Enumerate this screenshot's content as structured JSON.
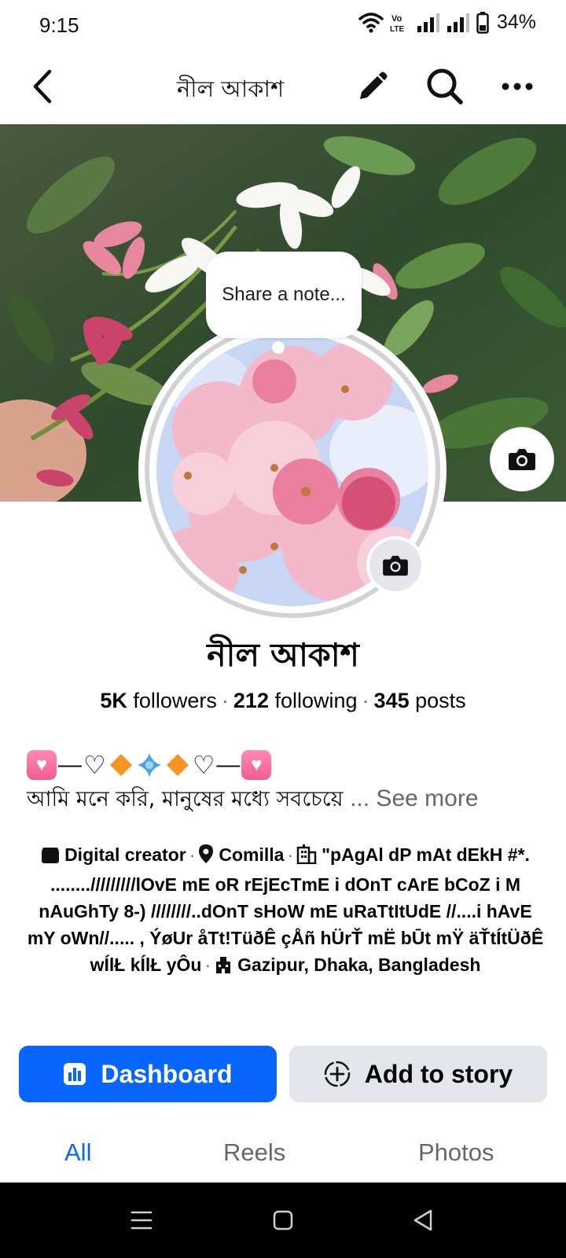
{
  "status_bar": {
    "time": "9:15",
    "battery": "34%"
  },
  "app_bar": {
    "title": "নীল আকাশ",
    "icons": [
      "back-icon",
      "pencil-icon",
      "search-icon",
      "more-icon"
    ]
  },
  "note": {
    "placeholder": "Share a note..."
  },
  "profile": {
    "name": "নীল আকাশ",
    "followers_count": "5K",
    "followers_label": "followers",
    "following_count": "212",
    "following_label": "following",
    "posts_count": "345",
    "posts_label": "posts"
  },
  "bio": {
    "text": "আমি মনে করি, মানুষের মধ্যে সবচেয়ে",
    "see_more": "... See more"
  },
  "details": {
    "category": "Digital creator",
    "location": "Comilla",
    "work": "\"pAgAl dP mAt dEkH #*. ......../////////lOvE mE  oR rEjEcTmE i dOnT cArE bCoZ i M nAuGhTy 8-)  ////////..dOnT sHoW mE uRaTtItUdE //....i hAvE  mY oWn//..... , ÝøUr åTt!TüðÊ çÅñ hÜrŤ mË bŪt  mŸ äŤtÍtÜðÊ wÍlŁ kÍlŁ yÔu",
    "current_city": "Gazipur, Dhaka, Bangladesh"
  },
  "actions": {
    "dashboard_label": "Dashboard",
    "story_label": "Add to story"
  },
  "tabs": [
    {
      "label": "All",
      "active": true
    },
    {
      "label": "Reels",
      "active": false
    },
    {
      "label": "Photos",
      "active": false
    }
  ],
  "colors": {
    "accent": "#0866ff",
    "secondary_button": "#e4e6eb",
    "muted_text": "#65676b"
  }
}
